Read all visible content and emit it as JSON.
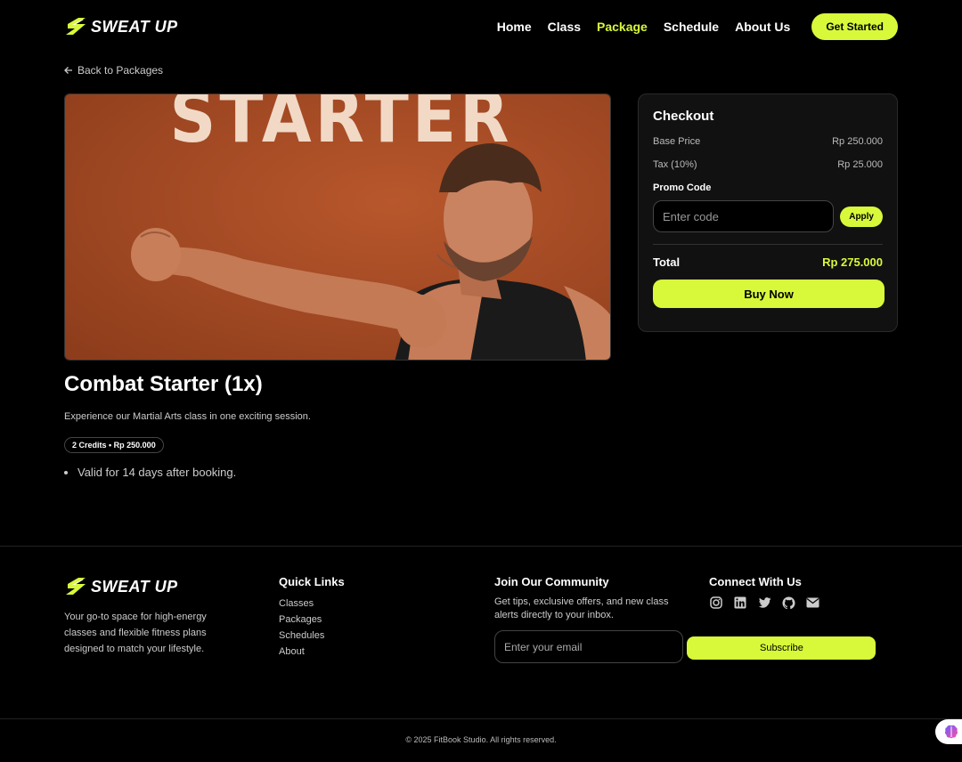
{
  "brand": {
    "name": "SWEAT UP"
  },
  "nav": {
    "items": [
      {
        "label": "Home"
      },
      {
        "label": "Class"
      },
      {
        "label": "Package"
      },
      {
        "label": "Schedule"
      },
      {
        "label": "About Us"
      }
    ],
    "cta": "Get Started"
  },
  "back_link": "Back to Packages",
  "hero": {
    "image_word": "STARTER"
  },
  "package": {
    "title": "Combat Starter (1x)",
    "description": "Experience our Martial Arts class in one exciting session.",
    "badge": "2 Credits • Rp 250.000",
    "bullets": [
      "Valid for 14 days after booking."
    ]
  },
  "checkout": {
    "title": "Checkout",
    "base_price_label": "Base Price",
    "base_price_value": "Rp 250.000",
    "tax_label": "Tax (10%)",
    "tax_value": "Rp 25.000",
    "promo_label": "Promo Code",
    "promo_placeholder": "Enter code",
    "apply_label": "Apply",
    "total_label": "Total",
    "total_value": "Rp 275.000",
    "buy_label": "Buy Now"
  },
  "footer": {
    "about": "Your go-to space for high-energy classes and flexible fitness plans designed to match your lifestyle.",
    "quick_links_title": "Quick Links",
    "quick_links": [
      "Classes",
      "Packages",
      "Schedules",
      "About"
    ],
    "community_title": "Join Our Community",
    "community_text": "Get tips, exclusive offers, and new class alerts directly to your inbox.",
    "email_placeholder": "Enter your email",
    "subscribe_label": "Subscribe",
    "connect_title": "Connect With Us",
    "social_icons": [
      "instagram-icon",
      "linkedin-icon",
      "twitter-icon",
      "github-icon",
      "mail-icon"
    ],
    "copyright": "© 2025 FitBook Studio. All rights reserved."
  },
  "colors": {
    "accent": "#d8f93a",
    "background": "#000000"
  }
}
